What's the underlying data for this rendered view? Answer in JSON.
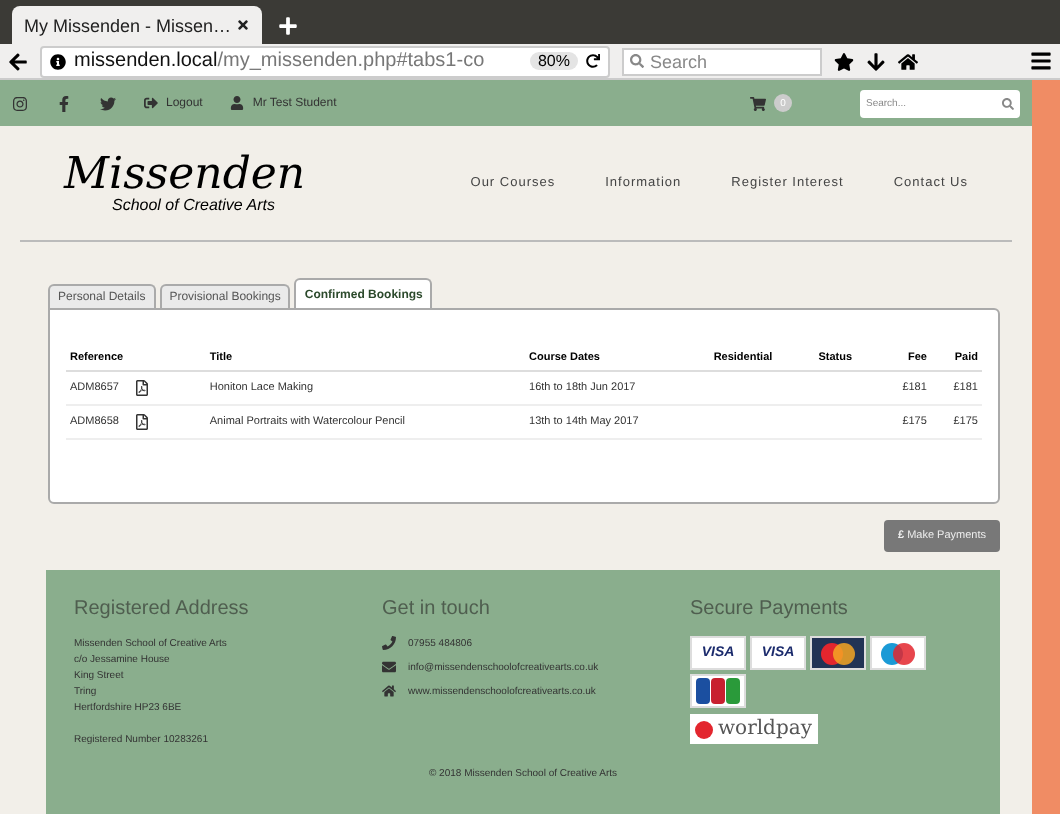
{
  "browser": {
    "tab_title": "My Missenden - Missen…",
    "url_host": "missenden.local",
    "url_path": "/my_missenden.php#tabs1-co",
    "zoom": "80%",
    "search_placeholder": "Search"
  },
  "topbar": {
    "logout": "Logout",
    "user": "Mr Test Student",
    "cart_count": "0",
    "search_placeholder": "Search..."
  },
  "logo": {
    "name": "Missenden",
    "tagline": "School of Creative Arts"
  },
  "nav": [
    "Our Courses",
    "Information",
    "Register Interest",
    "Contact Us"
  ],
  "tabs": [
    {
      "label": "Personal Details",
      "selected": false
    },
    {
      "label": "Provisional Bookings",
      "selected": false
    },
    {
      "label": "Confirmed Bookings",
      "selected": true
    }
  ],
  "table": {
    "columns": [
      "Reference",
      "Title",
      "Course Dates",
      "Residential",
      "Status",
      "Fee",
      "Paid"
    ],
    "rows": [
      {
        "reference": "ADM8657",
        "title": "Honiton Lace Making",
        "dates": "16th to 18th Jun 2017",
        "fee": "£181",
        "paid": "£181"
      },
      {
        "reference": "ADM8658",
        "title": "Animal Portraits with Watercolour Pencil",
        "dates": "13th to 14th May 2017",
        "fee": "£175",
        "paid": "£175"
      }
    ]
  },
  "make_payments": {
    "icon": "£",
    "label": "Make Payments"
  },
  "footer": {
    "address_title": "Registered Address",
    "address_lines": [
      "Missenden School of Creative Arts",
      "c/o Jessamine House",
      "King Street",
      "Tring",
      "Hertfordshire HP23 6BE"
    ],
    "reg_number": "Registered Number 10283261",
    "contact_title": "Get in touch",
    "phone": "07955 484806",
    "email": "info@missendenschoolofcreativearts.co.uk",
    "web": "www.missendenschoolofcreativearts.co.uk",
    "payments_title": "Secure Payments",
    "cards": [
      {
        "kind": "visa",
        "label": "VISA"
      },
      {
        "kind": "visa",
        "label": "VISA"
      },
      {
        "kind": "mastercard"
      },
      {
        "kind": "maestro"
      },
      {
        "kind": "jcb"
      }
    ],
    "worldpay": "worldpay",
    "copyright": "© 2018 Missenden School of Creative Arts"
  }
}
